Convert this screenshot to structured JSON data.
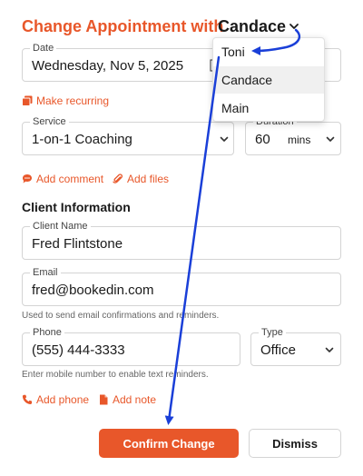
{
  "header": {
    "title": "Change Appointment with",
    "selected_name": "Candace"
  },
  "date_field": {
    "label": "Date",
    "value": "Wednesday, Nov 5, 2025"
  },
  "make_recurring": "Make recurring",
  "service_field": {
    "label": "Service",
    "value": "1-on-1 Coaching"
  },
  "duration_field": {
    "label": "Duration",
    "value": "60",
    "unit": "mins"
  },
  "add_comment": "Add comment",
  "add_files": "Add files",
  "client_section": {
    "title": "Client Information",
    "name_label": "Client Name",
    "name_value": "Fred Flintstone",
    "email_label": "Email",
    "email_value": "fred@bookedin.com",
    "email_help": "Used to send email confirmations and reminders.",
    "phone_label": "Phone",
    "phone_value": "(555) 444-3333",
    "phone_help": "Enter mobile number to enable text reminders.",
    "type_label": "Type",
    "type_value": "Office"
  },
  "add_phone": "Add phone",
  "add_note": "Add note",
  "buttons": {
    "confirm": "Confirm Change",
    "dismiss": "Dismiss"
  },
  "dropdown": {
    "options": [
      "Toni",
      "Candace",
      "Main"
    ],
    "highlighted": "Candace"
  },
  "colors": {
    "accent": "#e8572a",
    "annotation_arrow": "#1a3fd8"
  },
  "icons": {
    "recurring": "copy-icon",
    "comment": "comment-icon",
    "files": "paperclip-icon",
    "phone": "phone-icon",
    "note": "note-icon"
  }
}
